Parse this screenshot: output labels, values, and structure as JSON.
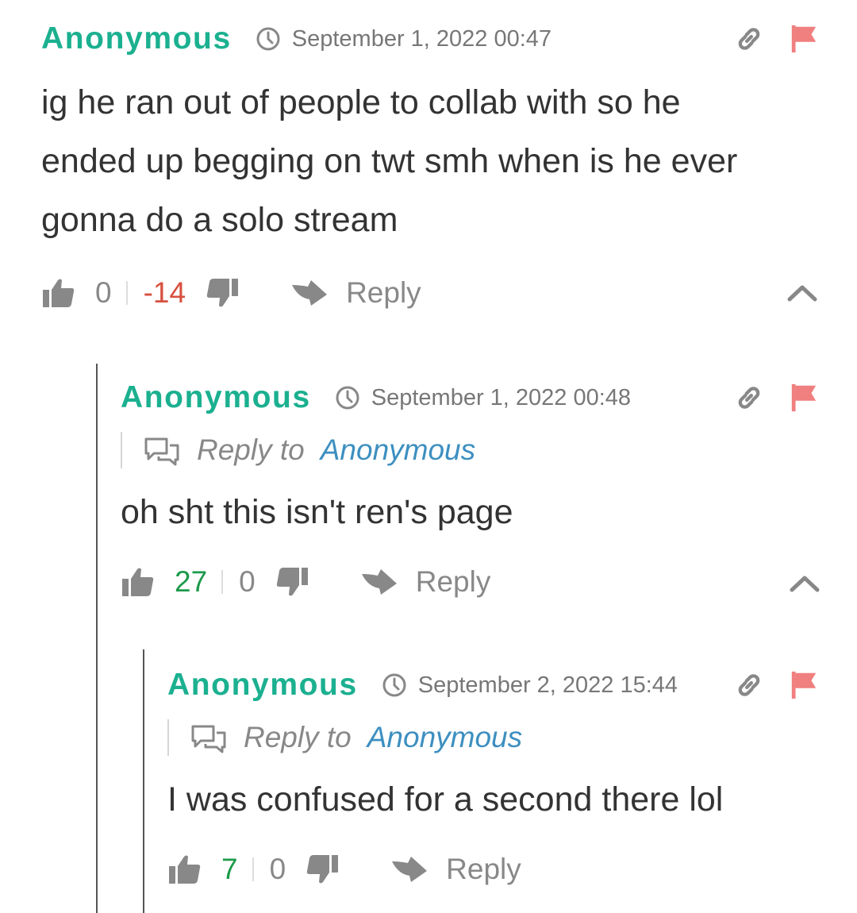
{
  "comments": [
    {
      "author": "Anonymous",
      "date": "September 1, 2022 00:47",
      "text_lines": [
        "ig he ran out of people to collab with so he",
        "ended up begging on twt smh when is he ever",
        "gonna do a solo stream"
      ],
      "likes": "0",
      "dislikes": "-14",
      "reply_label": "Reply"
    },
    {
      "author": "Anonymous",
      "date": "September 1, 2022 00:48",
      "reply_to_label": "Reply to",
      "reply_to_name": "Anonymous",
      "text_lines": [
        "oh sht this isn't ren's page"
      ],
      "likes": "27",
      "dislikes": "0",
      "reply_label": "Reply"
    },
    {
      "author": "Anonymous",
      "date": "September 2, 2022 15:44",
      "reply_to_label": "Reply to",
      "reply_to_name": "Anonymous",
      "text_lines": [
        "I was confused for a second there lol"
      ],
      "likes": "7",
      "dislikes": "0",
      "reply_label": "Reply"
    }
  ],
  "colors": {
    "author": "#1bb090",
    "positive": "#1c9a4a",
    "negative": "#d85040",
    "flag": "#f07f7f",
    "reply_to_name": "#3d8fc0"
  },
  "icons": [
    "clock-icon",
    "link-icon",
    "flag-icon",
    "thumbs-up-icon",
    "thumbs-down-icon",
    "reply-arrow-icon",
    "chat-bubbles-icon",
    "chevron-up-icon"
  ]
}
